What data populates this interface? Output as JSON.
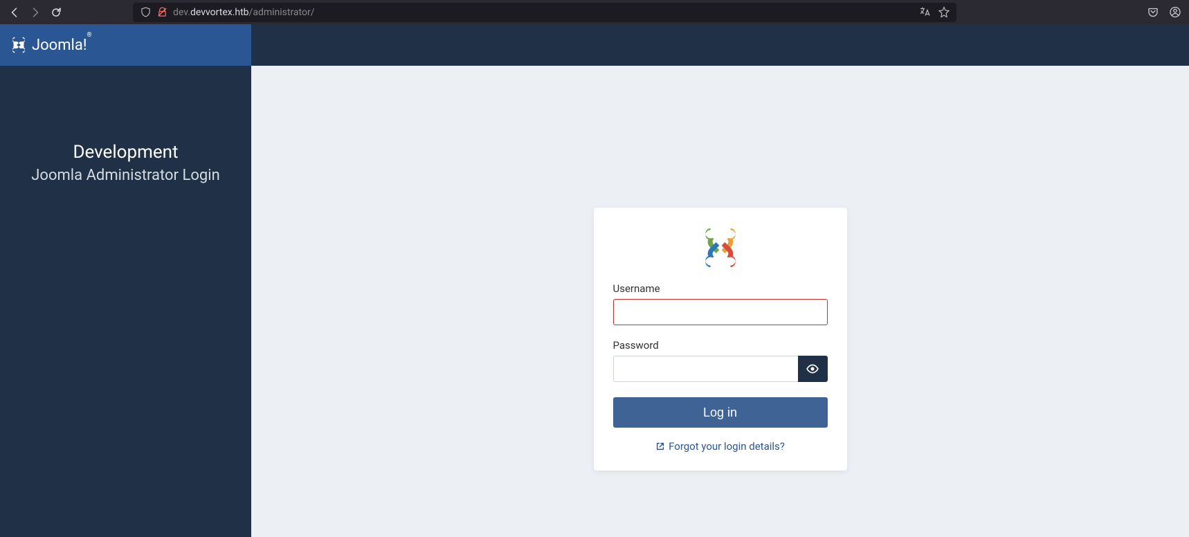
{
  "browser": {
    "url_prefix": "dev.",
    "url_domain": "devvortex.htb",
    "url_path": "/administrator/"
  },
  "sidebar": {
    "logo_text": "Joomla!",
    "title": "Development",
    "subtitle": "Joomla Administrator Login"
  },
  "login": {
    "username_label": "Username",
    "username_value": "",
    "password_label": "Password",
    "password_value": "",
    "login_button": "Log in",
    "forgot_link": "Forgot your login details?"
  }
}
